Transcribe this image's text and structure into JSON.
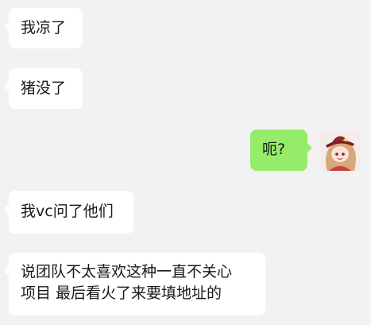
{
  "messages": [
    {
      "direction": "incoming",
      "lines": [
        "我凉了"
      ]
    },
    {
      "direction": "incoming",
      "lines": [
        "猪没了"
      ]
    },
    {
      "direction": "outgoing",
      "lines": [
        "呃?"
      ]
    },
    {
      "direction": "incoming",
      "lines": [
        "我vc问了他们"
      ]
    },
    {
      "direction": "incoming",
      "lines": [
        "说团队不太喜欢这种一直不关心",
        "项目 最后看火了来要填地址的"
      ]
    }
  ],
  "colors": {
    "background": "#f2f2f2",
    "incoming_bubble": "#ffffff",
    "outgoing_bubble": "#95ec69",
    "text": "#191919"
  },
  "avatar": {
    "icon": "anime-character-avatar-icon"
  }
}
